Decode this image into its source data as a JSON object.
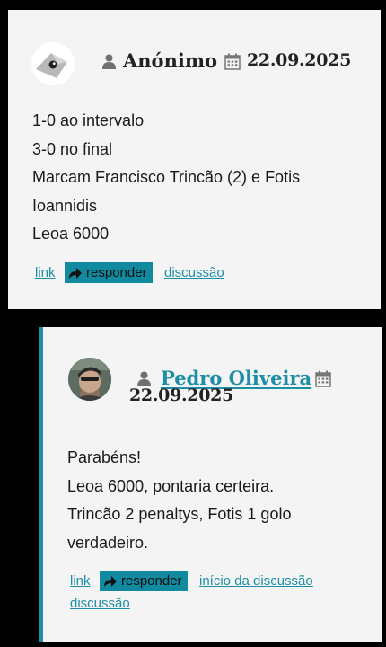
{
  "comments": [
    {
      "avatar_icon": "default-avatar-icon",
      "author": "Anónimo",
      "date": "22.09.2025",
      "lines": [
        "1-0 ao intervalo",
        "3-0 no final",
        "Marcam Francisco Trincão (2) e Fotis",
        "Ioannidis",
        "Leoa 6000"
      ],
      "actions": {
        "link": "link",
        "reply": "responder",
        "discussion": "discussão"
      }
    },
    {
      "avatar_icon": "user-photo-avatar",
      "author": "Pedro Oliveira",
      "date": "22.09.2025",
      "lines": [
        "Parabéns!",
        "Leoa 6000, pontaria certeira.",
        "Trincão 2 penaltys, Fotis 1 golo",
        "verdadeiro."
      ],
      "actions": {
        "link": "link",
        "reply": "responder",
        "thread_start": "início da discussão",
        "discussion": "discussão"
      }
    }
  ],
  "colors": {
    "accent": "#1c8fa6",
    "reply_bg": "#11899e",
    "card_bg": "#f4f4f4",
    "page_bg": "#000000"
  }
}
